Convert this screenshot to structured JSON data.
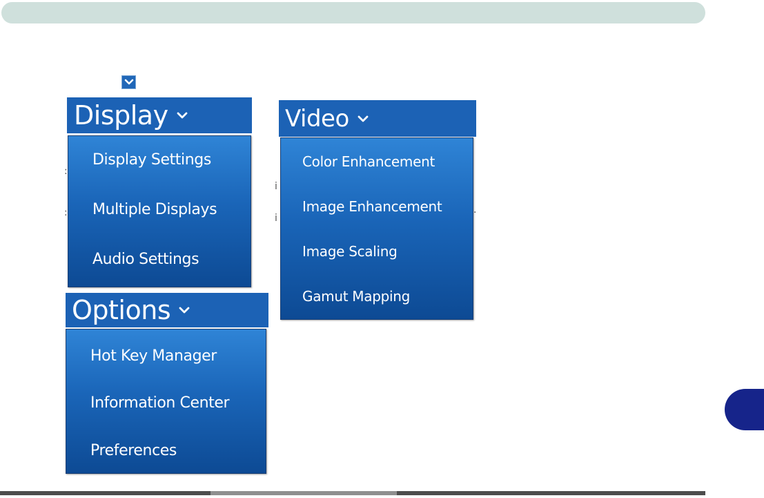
{
  "colors": {
    "header_bg": "#1c62b5",
    "panel_top": "#2f84d6",
    "panel_bottom": "#0d4a94",
    "top_bar": "#cfe0dc",
    "chapter_tab": "#16248a",
    "text": "#ffffff"
  },
  "small_icon": "chevron-down-icon",
  "display_menu": {
    "title": "Display",
    "items": [
      "Display Settings",
      "Multiple Displays",
      "Audio Settings"
    ]
  },
  "video_menu": {
    "title": "Video",
    "items": [
      "Color Enhancement",
      "Image Enhancement",
      "Image Scaling",
      "Gamut Mapping"
    ]
  },
  "options_menu": {
    "title": "Options",
    "items": [
      "Hot Key Manager",
      "Information Center",
      "Preferences"
    ]
  }
}
